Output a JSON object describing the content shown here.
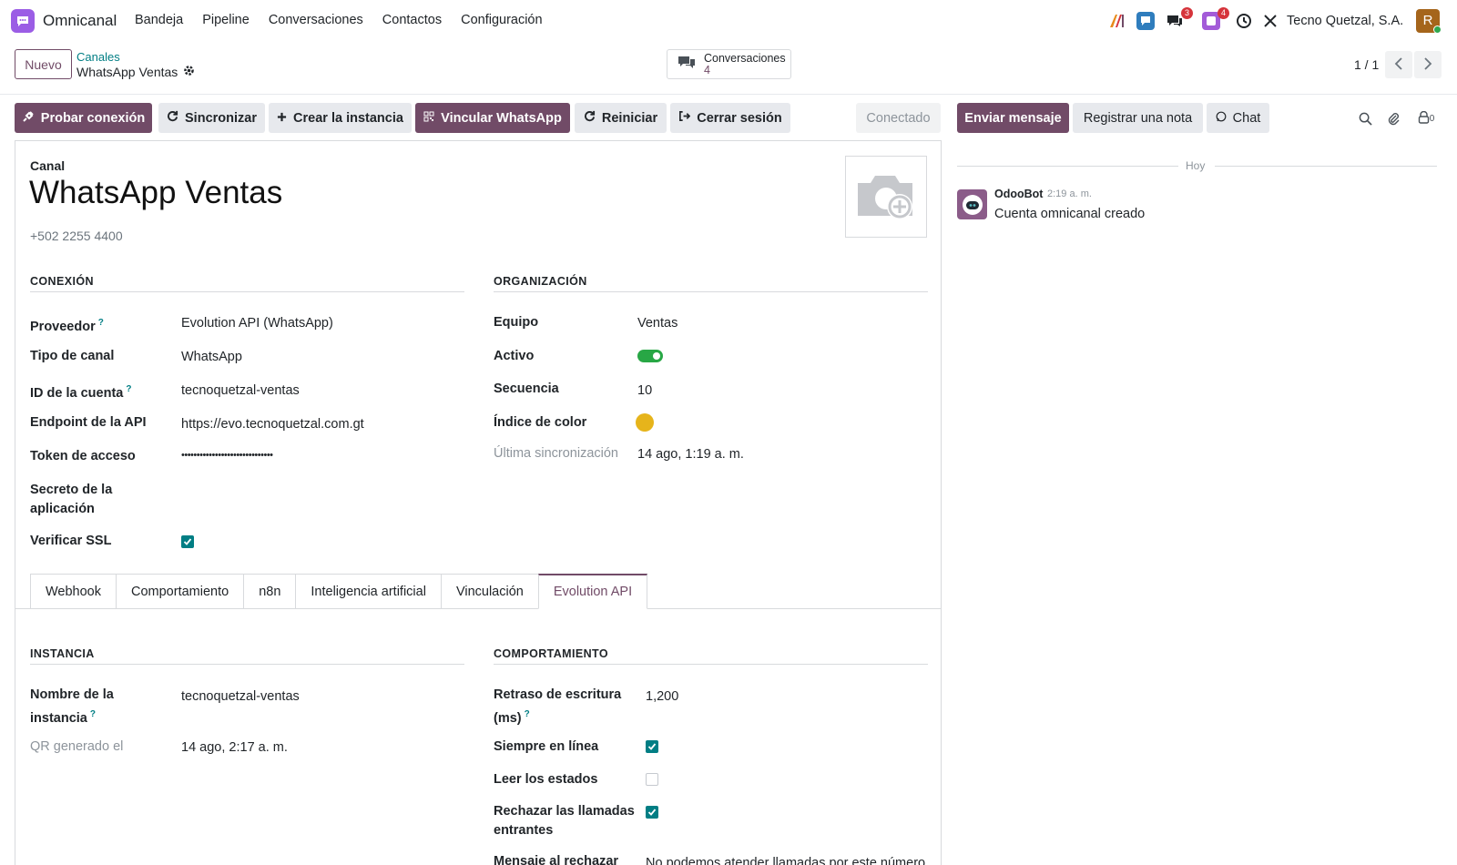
{
  "app": {
    "name": "Omnicanal"
  },
  "menu": [
    "Bandeja",
    "Pipeline",
    "Conversaciones",
    "Contactos",
    "Configuración"
  ],
  "systray": {
    "discuss_badge": "3",
    "activity_badge": "4",
    "company": "Tecno Quetzal, S.A.",
    "avatar_letter": "R"
  },
  "control": {
    "new_label": "Nuevo",
    "breadcrumb_parent": "Canales",
    "breadcrumb_current": "WhatsApp Ventas",
    "smart_label": "Conversaciones",
    "smart_count": "4",
    "pager": "1 / 1"
  },
  "statusbar": {
    "buttons": [
      "Probar conexión",
      "Sincronizar",
      "Crear la instancia",
      "Vincular WhatsApp",
      "Reiniciar",
      "Cerrar sesión"
    ],
    "state": "Conectado"
  },
  "form": {
    "record_label": "Canal",
    "title": "WhatsApp Ventas",
    "phone": "+502 2255 4400",
    "connection": {
      "heading": "CONEXIÓN",
      "fields": [
        {
          "label": "Proveedor",
          "value": "Evolution API (WhatsApp)",
          "help": "?"
        },
        {
          "label": "Tipo de canal",
          "value": "WhatsApp"
        },
        {
          "label": "ID de la cuenta",
          "value": "tecnoquetzal-ventas",
          "help": "?"
        },
        {
          "label": "Endpoint de la API",
          "value": "https://evo.tecnoquetzal.com.gt"
        },
        {
          "label": "Token de acceso",
          "value": "••••••••••••••••••••••••••••••"
        },
        {
          "label": "Secreto de la aplicación",
          "value": ""
        },
        {
          "label": "Verificar SSL",
          "checked": true
        }
      ]
    },
    "organization": {
      "heading": "ORGANIZACIÓN",
      "fields": [
        {
          "label": "Equipo",
          "value": "Ventas"
        },
        {
          "label": "Activo",
          "active": true
        },
        {
          "label": "Secuencia",
          "value": "10"
        },
        {
          "label": "Índice de color",
          "color": "#e6b41b"
        },
        {
          "label": "Última sincronización",
          "value": "14 ago, 1:19 a. m."
        }
      ]
    },
    "tabs": [
      "Webhook",
      "Comportamiento",
      "n8n",
      "Inteligencia artificial",
      "Vinculación",
      "Evolution API"
    ],
    "active_tab": "Evolution API",
    "instance": {
      "heading": "INSTANCIA",
      "fields": [
        {
          "label": "Nombre de la instancia",
          "value": "tecnoquetzal-ventas",
          "help": "?"
        },
        {
          "label": "QR generado el",
          "value": "14 ago, 2:17 a. m."
        }
      ]
    },
    "behavior": {
      "heading": "COMPORTAMIENTO",
      "fields": [
        {
          "label": "Retraso de escritura (ms)",
          "value": "1,200",
          "help": "?"
        },
        {
          "label": "Siempre en línea",
          "checked": true
        },
        {
          "label": "Leer los estados",
          "checked": false
        },
        {
          "label": "Rechazar las llamadas entrantes",
          "checked": true
        },
        {
          "label": "Mensaje al rechazar",
          "value": "No podemos atender llamadas por este número."
        }
      ]
    }
  },
  "chatter": {
    "send_label": "Enviar mensaje",
    "note_label": "Registrar una nota",
    "chat_label": "Chat",
    "followers": "0",
    "today": "Hoy",
    "message": {
      "author": "OdooBot",
      "time": "2:19 a. m.",
      "body": "Cuenta omnicanal creado"
    }
  },
  "colors": {
    "primary": "#714b67",
    "link": "#017e84",
    "success": "#28a745"
  }
}
